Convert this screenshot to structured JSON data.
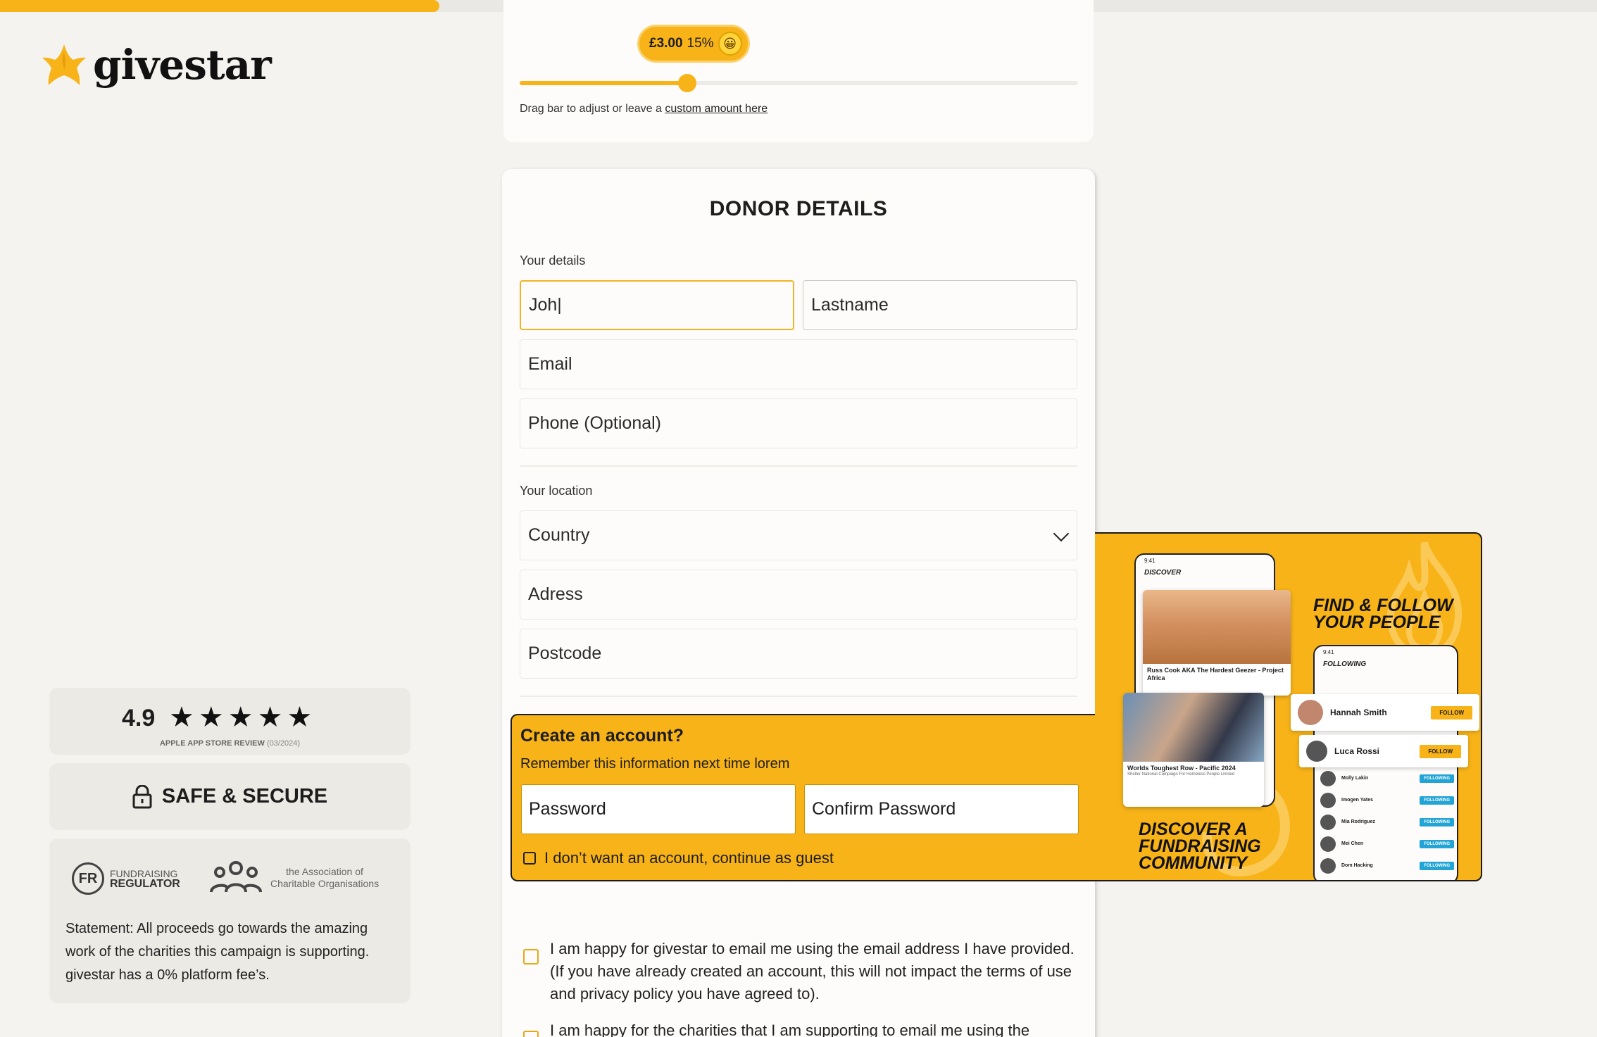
{
  "progress": {
    "fraction": 0.4
  },
  "logo": {
    "text": "givestar"
  },
  "tip": {
    "amount": "£3.00",
    "percent": "15%",
    "emoji": "😀",
    "slider_fraction": 0.3,
    "hint_prefix": "Drag bar to adjust or leave a ",
    "hint_link": "custom amount here"
  },
  "donor": {
    "title": "DONOR DETAILS",
    "your_details_label": "Your details",
    "firstname_value": "Joh|",
    "lastname_placeholder": "Lastname",
    "email_placeholder": "Email",
    "phone_placeholder": "Phone (Optional)",
    "your_location_label": "Your location",
    "country_placeholder": "Country",
    "address_placeholder": "Adress",
    "postcode_placeholder": "Postcode"
  },
  "account": {
    "title": "Create an account?",
    "subtitle": "Remember this information next time lorem",
    "password_placeholder": "Password",
    "confirm_placeholder": "Confirm Password",
    "guest_label": "I don’t want an account, continue as guest"
  },
  "promo": {
    "headline_line1": "FIND & FOLLOW",
    "headline_line2": "YOUR PEOPLE",
    "footer_line1": "DISCOVER A",
    "footer_line2": "FUNDRAISING",
    "footer_line3": "COMMUNITY",
    "phone_time": "9:41",
    "discover_title": "DISCOVER",
    "following_title": "FOLLOWING",
    "card1_title": "Russ Cook AKA The Hardest Geezer - Project Africa",
    "card2_title": "Worlds Toughest Row - Pacific 2024",
    "card2_sub": "Shelter National Campaign For Homeless People Limited",
    "follow1_name": "Hannah Smith",
    "follow2_name": "Luca Rossi",
    "follow_button": "FOLLOW",
    "following_list": [
      "Molly Lakin",
      "Imogen Yates",
      "Mia Rodriguez",
      "Mei Chen",
      "Dom Hacking"
    ],
    "following_tag": "FOLLOWING"
  },
  "consent": {
    "email_givestar": "I am happy for givestar to email me using the email address I have provided. (If you have already created an account, this will not impact the terms of use and privacy policy you have agreed to).",
    "email_charities": "I am happy for the charities that I am supporting to email me using the"
  },
  "trust": {
    "rating": "4.9",
    "stars": 5,
    "rating_caption": "APPLE APP STORE REVIEW",
    "rating_date": "(03/2024)",
    "safe_label": "SAFE & SECURE",
    "fr_line1": "FUNDRAISING",
    "fr_line2": "REGULATOR",
    "aco_line1": "the Association of",
    "aco_line2": "Charitable Organisations",
    "statement": "Statement: All proceeds go towards the amazing work of the charities this campaign is supporting. givestar has a 0% platform fee’s."
  },
  "colors": {
    "accent": "#f7b318",
    "background": "#f4f3f0",
    "card": "#fdfcfa"
  }
}
